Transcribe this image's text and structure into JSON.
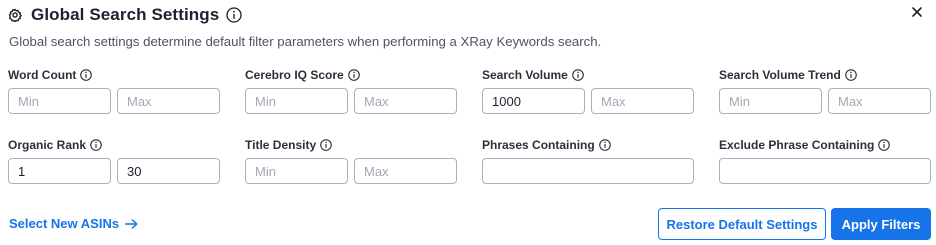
{
  "header": {
    "title": "Global Search Settings",
    "icon": "gear-icon",
    "info_icon": "info-icon",
    "close_icon": "close-icon",
    "description": "Global search settings determine default filter parameters when performing a XRay Keywords search."
  },
  "fields": {
    "word_count": {
      "label": "Word Count",
      "min_value": "",
      "max_value": "",
      "min_placeholder": "Min",
      "max_placeholder": "Max"
    },
    "cerebro_iq": {
      "label": "Cerebro IQ Score",
      "min_value": "",
      "max_value": "",
      "min_placeholder": "Min",
      "max_placeholder": "Max"
    },
    "search_volume": {
      "label": "Search Volume",
      "min_value": "1000",
      "max_value": "",
      "min_placeholder": "Min",
      "max_placeholder": "Max"
    },
    "search_volume_trend": {
      "label": "Search Volume Trend",
      "min_value": "",
      "max_value": "",
      "min_placeholder": "Min",
      "max_placeholder": "Max"
    },
    "organic_rank": {
      "label": "Organic Rank",
      "min_value": "1",
      "max_value": "30",
      "min_placeholder": "Min",
      "max_placeholder": "Max"
    },
    "title_density": {
      "label": "Title Density",
      "min_value": "",
      "max_value": "",
      "min_placeholder": "Min",
      "max_placeholder": "Max"
    },
    "phrases_containing": {
      "label": "Phrases Containing",
      "value": ""
    },
    "exclude_phrase_containing": {
      "label": "Exclude Phrase Containing",
      "value": ""
    }
  },
  "footer": {
    "select_asins_label": "Select New ASINs",
    "arrow_icon": "arrow-right-icon",
    "restore_label": "Restore Default Settings",
    "apply_label": "Apply Filters"
  },
  "colors": {
    "accent": "#1773e8",
    "border": "#a9b1bf",
    "text": "#1c2230",
    "muted": "#4d5466"
  }
}
